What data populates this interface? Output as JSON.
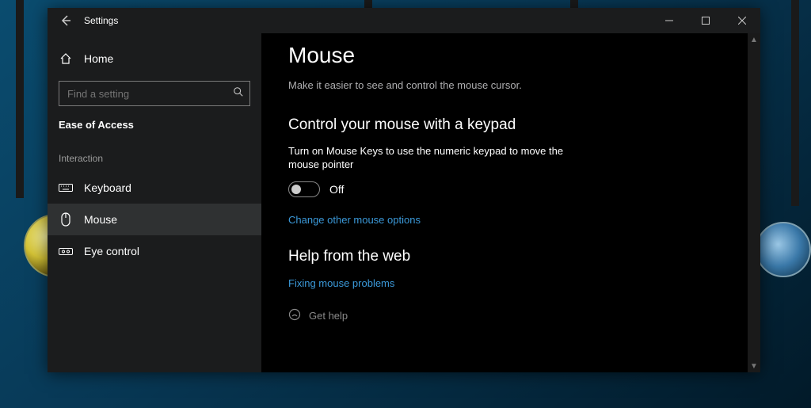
{
  "titlebar": {
    "title": "Settings"
  },
  "sidebar": {
    "home": "Home",
    "search_placeholder": "Find a setting",
    "group": "Ease of Access",
    "section": "Interaction",
    "items": [
      {
        "label": "Keyboard"
      },
      {
        "label": "Mouse"
      },
      {
        "label": "Eye control"
      }
    ]
  },
  "content": {
    "title": "Mouse",
    "subtitle": "Make it easier to see and control the mouse cursor.",
    "section1_title": "Control your mouse with a keypad",
    "section1_desc": "Turn on Mouse Keys to use the numeric keypad to move the mouse pointer",
    "toggle_state": "Off",
    "link1": "Change other mouse options",
    "section2_title": "Help from the web",
    "link2": "Fixing mouse problems",
    "get_help": "Get help"
  }
}
